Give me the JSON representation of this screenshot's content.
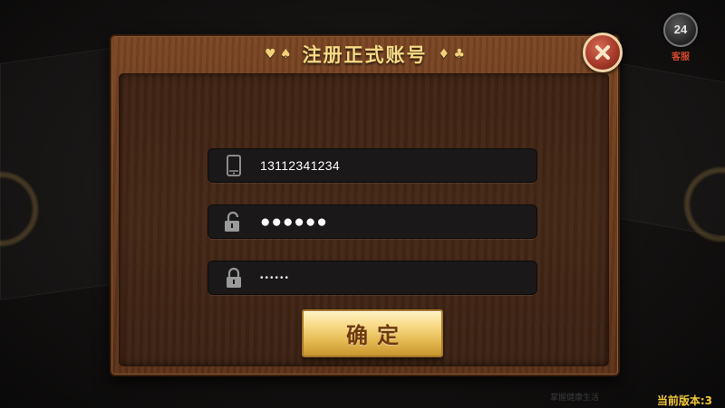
{
  "service": {
    "badge_text": "24",
    "label": "客服"
  },
  "dialog": {
    "title": "注册正式账号",
    "left_suits": "♥ ♠",
    "right_suits": "♦ ♣",
    "close_icon": "close-x-icon"
  },
  "form": {
    "phone_value": "13112341234",
    "password_value": "●●●●●●",
    "confirm_password_value": "••••••"
  },
  "confirm_button": {
    "label": "确定"
  },
  "footer": {
    "hint": "掌握健康生活",
    "version": "当前版本:3"
  },
  "colors": {
    "title_gold": "#f6dc86",
    "button_gold": "#f7d883",
    "version_yellow": "#f0c83a",
    "close_red": "#a63b2a"
  }
}
